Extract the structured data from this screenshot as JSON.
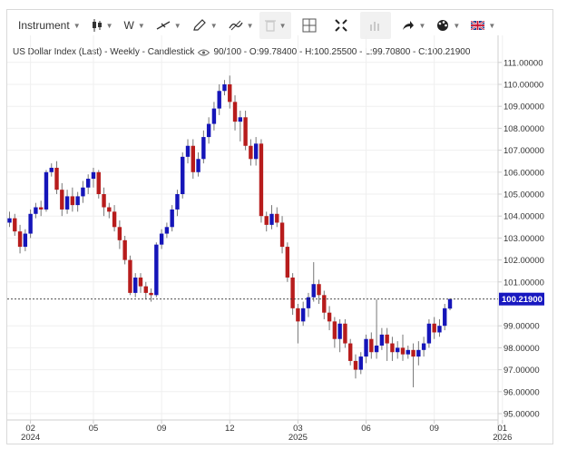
{
  "toolbar": {
    "instrument_label": "Instrument",
    "interval_label": "W",
    "chart_type_icon": "candlestick-icon",
    "line_tool_icon": "trend-line-icon",
    "draw_tool_icon": "pencil-icon",
    "indicator_icon": "indicator-icon",
    "delete_icon": "trash-icon",
    "crosshair_icon": "crosshair-icon",
    "fullscreen_icon": "fullscreen-icon",
    "volume_icon": "volume-bars-icon",
    "share_icon": "share-arrow-icon",
    "theme_icon": "palette-icon",
    "language_icon": "uk-flag-icon"
  },
  "legend": {
    "title": "US Dollar Index (Last) - Weekly - Candlestick",
    "values": "90/100 - O:99.78400 - H:100.25500 - L:99.70800 - C:100.21900"
  },
  "colors": {
    "up": "#1515b9",
    "down": "#b71c1c",
    "wick": "#777777",
    "price_label_bg": "#1818c0"
  },
  "chart_data": {
    "type": "candlestick",
    "title": "US Dollar Index (Last) - Weekly - Candlestick",
    "current_price": 100.219,
    "current_price_label": "100.21900",
    "ylim": [
      94.7,
      112.3
    ],
    "y_ticks": [
      {
        "v": 111,
        "label": "111.00000"
      },
      {
        "v": 110,
        "label": "110.00000"
      },
      {
        "v": 109,
        "label": "109.00000"
      },
      {
        "v": 108,
        "label": "108.00000"
      },
      {
        "v": 107,
        "label": "107.00000"
      },
      {
        "v": 106,
        "label": "106.00000"
      },
      {
        "v": 105,
        "label": "105.00000"
      },
      {
        "v": 104,
        "label": "104.00000"
      },
      {
        "v": 103,
        "label": "103.00000"
      },
      {
        "v": 102,
        "label": "102.00000"
      },
      {
        "v": 101,
        "label": "101.00000"
      },
      {
        "v": 99,
        "label": "99.00000"
      },
      {
        "v": 98,
        "label": "98.00000"
      },
      {
        "v": 97,
        "label": "97.00000"
      },
      {
        "v": 96,
        "label": "96.00000"
      },
      {
        "v": 95,
        "label": "95.00000"
      }
    ],
    "x_ticks": [
      {
        "i": 4,
        "label": "02",
        "year": "2024"
      },
      {
        "i": 16,
        "label": "05"
      },
      {
        "i": 29,
        "label": "09"
      },
      {
        "i": 42,
        "label": "12"
      },
      {
        "i": 55,
        "label": "03",
        "year": "2025"
      },
      {
        "i": 68,
        "label": "06"
      },
      {
        "i": 81,
        "label": "09"
      },
      {
        "i": 94,
        "label": "01",
        "year": "2026"
      }
    ],
    "candles": [
      [
        103.7,
        103.9,
        104.2,
        103.5
      ],
      [
        103.9,
        103.3,
        104.1,
        103.1
      ],
      [
        103.3,
        102.6,
        103.6,
        102.3
      ],
      [
        102.6,
        103.2,
        103.4,
        102.4
      ],
      [
        103.2,
        104.1,
        104.3,
        103.0
      ],
      [
        104.1,
        104.4,
        104.6,
        103.9
      ],
      [
        104.4,
        104.3,
        104.7,
        104.0
      ],
      [
        104.3,
        106.0,
        106.1,
        104.2
      ],
      [
        106.0,
        106.2,
        106.4,
        105.8
      ],
      [
        106.2,
        105.2,
        106.5,
        105.0
      ],
      [
        105.2,
        104.3,
        105.5,
        104.0
      ],
      [
        104.3,
        104.9,
        105.2,
        104.1
      ],
      [
        104.9,
        104.5,
        105.3,
        104.2
      ],
      [
        104.5,
        104.9,
        105.1,
        104.2
      ],
      [
        104.9,
        105.3,
        105.6,
        104.6
      ],
      [
        105.3,
        105.7,
        105.9,
        105.0
      ],
      [
        105.7,
        106.0,
        106.2,
        105.3
      ],
      [
        106.0,
        105.0,
        106.1,
        104.8
      ],
      [
        105.0,
        104.4,
        105.3,
        104.0
      ],
      [
        104.4,
        104.2,
        104.6,
        103.9
      ],
      [
        104.2,
        103.5,
        104.5,
        103.3
      ],
      [
        103.5,
        102.9,
        103.8,
        102.5
      ],
      [
        102.9,
        102.0,
        103.1,
        101.8
      ],
      [
        102.0,
        100.5,
        102.2,
        100.4
      ],
      [
        100.5,
        101.2,
        101.4,
        100.3
      ],
      [
        101.2,
        100.8,
        101.4,
        100.5
      ],
      [
        100.8,
        100.5,
        101.0,
        100.2
      ],
      [
        100.5,
        100.4,
        100.7,
        100.1
      ],
      [
        100.4,
        102.7,
        102.8,
        100.3
      ],
      [
        102.7,
        103.2,
        103.4,
        102.5
      ],
      [
        103.2,
        103.5,
        103.7,
        103.0
      ],
      [
        103.5,
        104.3,
        104.5,
        103.3
      ],
      [
        104.3,
        105.0,
        105.2,
        104.0
      ],
      [
        105.0,
        106.7,
        106.9,
        104.8
      ],
      [
        106.7,
        107.2,
        107.5,
        106.4
      ],
      [
        107.2,
        106.0,
        107.5,
        105.7
      ],
      [
        106.0,
        106.6,
        106.9,
        105.8
      ],
      [
        106.6,
        107.6,
        107.9,
        106.4
      ],
      [
        107.6,
        108.2,
        108.5,
        107.3
      ],
      [
        108.2,
        108.9,
        109.2,
        107.9
      ],
      [
        108.9,
        109.7,
        110.0,
        108.6
      ],
      [
        109.7,
        110.0,
        110.2,
        109.5
      ],
      [
        110.0,
        109.2,
        110.4,
        108.9
      ],
      [
        109.2,
        108.3,
        109.5,
        107.9
      ],
      [
        108.3,
        108.5,
        108.8,
        107.4
      ],
      [
        108.5,
        107.2,
        108.8,
        107.0
      ],
      [
        107.2,
        106.6,
        107.5,
        106.3
      ],
      [
        106.6,
        107.3,
        107.6,
        106.3
      ],
      [
        107.3,
        104.0,
        107.5,
        103.7
      ],
      [
        104.0,
        103.6,
        104.2,
        103.3
      ],
      [
        103.6,
        104.1,
        104.5,
        103.4
      ],
      [
        104.1,
        103.7,
        104.4,
        103.5
      ],
      [
        103.7,
        102.6,
        104.0,
        102.3
      ],
      [
        102.6,
        101.2,
        102.8,
        101.0
      ],
      [
        101.2,
        99.8,
        101.4,
        99.5
      ],
      [
        99.8,
        99.2,
        100.0,
        98.2
      ],
      [
        99.2,
        99.8,
        100.1,
        99.0
      ],
      [
        99.8,
        100.3,
        100.5,
        99.4
      ],
      [
        100.3,
        100.9,
        101.9,
        100.1
      ],
      [
        100.9,
        100.4,
        101.1,
        100.0
      ],
      [
        100.4,
        99.6,
        100.6,
        99.3
      ],
      [
        99.6,
        99.2,
        99.9,
        98.8
      ],
      [
        99.2,
        98.4,
        99.4,
        98.0
      ],
      [
        98.4,
        99.1,
        99.3,
        97.8
      ],
      [
        99.1,
        98.2,
        99.3,
        98.0
      ],
      [
        98.2,
        97.4,
        98.4,
        97.2
      ],
      [
        97.4,
        97.0,
        97.7,
        96.6
      ],
      [
        97.0,
        97.6,
        97.8,
        96.8
      ],
      [
        97.6,
        98.4,
        98.6,
        97.3
      ],
      [
        98.4,
        97.8,
        98.7,
        97.5
      ],
      [
        97.8,
        98.1,
        100.2,
        97.5
      ],
      [
        98.1,
        98.6,
        98.9,
        97.9
      ],
      [
        98.6,
        98.2,
        98.9,
        97.4
      ],
      [
        98.2,
        97.8,
        98.5,
        97.4
      ],
      [
        97.8,
        98.0,
        98.3,
        97.5
      ],
      [
        98.0,
        97.7,
        98.6,
        97.4
      ],
      [
        97.7,
        97.9,
        98.1,
        97.5
      ],
      [
        97.9,
        97.6,
        98.2,
        96.2
      ],
      [
        97.6,
        97.9,
        98.3,
        97.2
      ],
      [
        97.9,
        98.2,
        98.5,
        97.6
      ],
      [
        98.2,
        99.1,
        99.3,
        98.0
      ],
      [
        99.1,
        98.7,
        99.4,
        98.4
      ],
      [
        98.7,
        99.0,
        99.3,
        98.5
      ],
      [
        99.0,
        99.8,
        100.0,
        98.8
      ],
      [
        99.784,
        100.219,
        100.255,
        99.708
      ]
    ]
  }
}
